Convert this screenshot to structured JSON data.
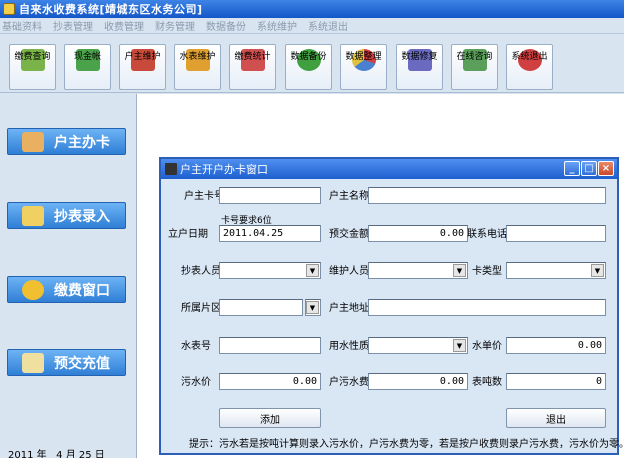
{
  "window": {
    "title": "自来水收费系统[靖城东区水务公司]"
  },
  "menu": [
    "基础资料",
    "抄表管理",
    "收费管理",
    "财务管理",
    "数据备份",
    "系统维护",
    "系统退出"
  ],
  "toolbar": [
    {
      "label": "缴费查询",
      "icon": "search-icon",
      "color": "#7ab34a"
    },
    {
      "label": "现金帐",
      "icon": "cash-icon",
      "color": "#4aa34a"
    },
    {
      "label": "户主维护",
      "icon": "users-icon",
      "color": "#c84a3a"
    },
    {
      "label": "水表维护",
      "icon": "pencil-icon",
      "color": "#e0a030"
    },
    {
      "label": "缴费统计",
      "icon": "stats-icon",
      "color": "#d05050"
    },
    {
      "label": "数据备份",
      "icon": "backup-icon",
      "color": "#40a040"
    },
    {
      "label": "数据整理",
      "icon": "pie-icon",
      "color": "#4a80d0"
    },
    {
      "label": "数据修复",
      "icon": "repair-icon",
      "color": "#6a6ac0"
    },
    {
      "label": "在线咨询",
      "icon": "consult-icon",
      "color": "#5aa05a"
    },
    {
      "label": "系统退出",
      "icon": "exit-icon",
      "color": "#d04040"
    }
  ],
  "sidebar": [
    {
      "label": "户主办卡",
      "icon": "card-user-icon"
    },
    {
      "label": "抄表录入",
      "icon": "meter-entry-icon"
    },
    {
      "label": "缴费窗口",
      "icon": "coins-icon"
    },
    {
      "label": "预交充值",
      "icon": "prepay-icon"
    }
  ],
  "status_date": "2011 年   4 月 25 日",
  "dialog": {
    "title": "户主开户办卡窗口",
    "labels": {
      "card_no": "户主卡号",
      "owner_name": "户主名称",
      "card_hint": "卡号要求6位",
      "open_date": "立户日期",
      "prepay": "预交金额",
      "phone": "联系电话",
      "reader": "抄表人员",
      "maintainer": "维护人员",
      "card_type": "卡类型",
      "area": "所属片区",
      "address": "户主地址",
      "meter_no": "水表号",
      "water_type": "用水性质",
      "water_price": "水单价",
      "sewage_price": "污水价",
      "owner_sewage": "户污水费",
      "tonnage": "表吨数"
    },
    "values": {
      "open_date": "2011.04.25",
      "prepay": "0.00",
      "water_price": "0.00",
      "sewage_price": "0.00",
      "owner_sewage": "0.00",
      "tonnage": "0"
    },
    "buttons": {
      "add": "添加",
      "exit": "退出"
    },
    "hint": "提示：污水若是按吨计算则录入污水价，户污水费为零，若是按户收费则录户污水费，污水价为零。"
  }
}
